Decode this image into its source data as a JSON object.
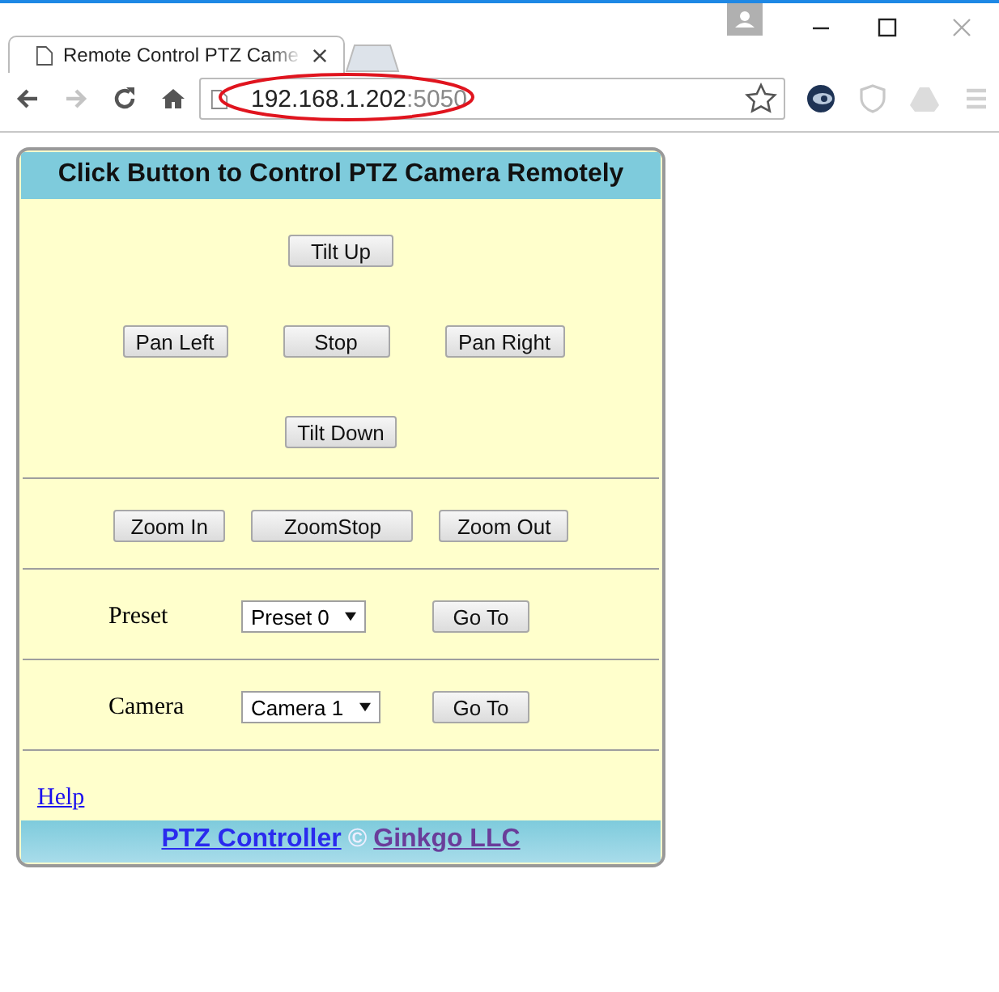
{
  "browser": {
    "tabs": [
      {
        "title": "Remote Control PTZ Came",
        "selected": true
      }
    ],
    "nav_buttons": [
      {
        "kind": "back",
        "disabled": false
      },
      {
        "kind": "forward",
        "disabled": true
      },
      {
        "kind": "reload",
        "disabled": false
      },
      {
        "kind": "home",
        "disabled": false
      }
    ],
    "address": {
      "host": "192.168.1.202",
      "port": ":5050"
    }
  },
  "page": {
    "header": "Click Button to Control PTZ Camera Remotely",
    "pan_tilt_rows": [
      [
        "Tilt Up"
      ],
      [
        "Pan Left",
        "Stop",
        "Pan Right"
      ],
      [
        "Tilt Down"
      ]
    ],
    "zoom_buttons": [
      "Zoom In",
      "ZoomStop",
      "Zoom Out"
    ],
    "selectors": [
      {
        "label": "Preset",
        "value": "Preset 0",
        "button": "Go To"
      },
      {
        "label": "Camera",
        "value": "Camera 1",
        "button": "Go To"
      }
    ],
    "help_link": "Help",
    "footer": [
      {
        "kind": "link",
        "text": "PTZ Controller",
        "visited": false
      },
      {
        "kind": "symbol",
        "text": "©"
      },
      {
        "kind": "link",
        "text": "Ginkgo LLC",
        "visited": true
      }
    ]
  }
}
